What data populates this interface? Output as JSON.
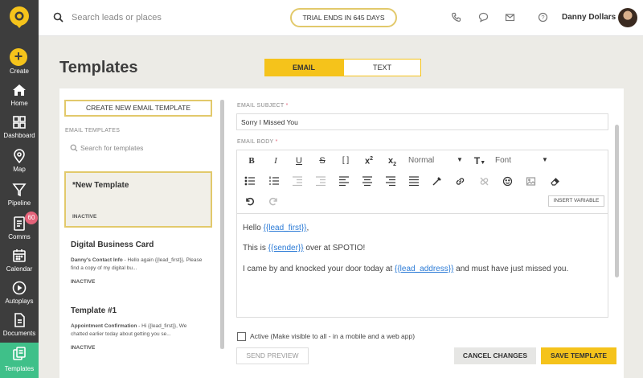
{
  "sidebar": {
    "items": [
      {
        "label": "Create",
        "icon": "plus-circle-icon"
      },
      {
        "label": "Home",
        "icon": "home-icon"
      },
      {
        "label": "Dashboard",
        "icon": "grid-icon"
      },
      {
        "label": "Map",
        "icon": "map-pin-icon"
      },
      {
        "label": "Pipeline",
        "icon": "funnel-icon"
      },
      {
        "label": "Comms",
        "icon": "document-icon",
        "badge": "60"
      },
      {
        "label": "Calendar",
        "icon": "calendar-icon"
      },
      {
        "label": "Autoplays",
        "icon": "play-circle-icon"
      },
      {
        "label": "Documents",
        "icon": "documents-icon"
      },
      {
        "label": "Templates",
        "icon": "templates-icon",
        "active": true
      }
    ]
  },
  "topbar": {
    "search_placeholder": "Search leads or places",
    "trial_text": "TRIAL ENDS IN 645 DAYS",
    "user_name": "Danny Dollars"
  },
  "page": {
    "title": "Templates",
    "tabs": [
      "EMAIL",
      "TEXT"
    ],
    "active_tab": "EMAIL"
  },
  "template_list": {
    "create_button": "CREATE NEW EMAIL TEMPLATE",
    "section_label": "EMAIL TEMPLATES",
    "search_placeholder": "Search for templates",
    "items": [
      {
        "title": "*New Template",
        "desc_bold": "",
        "desc": "",
        "status": "INACTIVE"
      },
      {
        "title": "Digital Business Card",
        "desc_bold": "Danny's Contact Info",
        "desc": " - Hello again {{lead_first}}, Please find a copy of my digital bu...",
        "status": "INACTIVE"
      },
      {
        "title": "Template #1",
        "desc_bold": "Appointment Confirmation",
        "desc": " - Hi {{lead_first}}, We chatted earlier today about getting you se...",
        "status": "INACTIVE"
      }
    ]
  },
  "editor": {
    "subject_label": "EMAIL SUBJECT",
    "required_mark": "*",
    "subject_value": "Sorry I Missed You",
    "body_label": "EMAIL BODY",
    "toolbar": {
      "paragraph_style": "Normal",
      "font": "Font",
      "insert_variable": "INSERT VARIABLE"
    },
    "body": {
      "line1_pre": "Hello ",
      "line1_token": "{{lead_first}}",
      "line1_post": ",",
      "line2_pre": "This is ",
      "line2_token": "{{sender}}",
      "line2_post": " over at SPOTIO!",
      "line3_pre": "I came by and knocked your door today at ",
      "line3_token": "{{lead_address}}",
      "line3_post": " and must have just missed you."
    },
    "active_label": "Active (Make visible to all - in a mobile and a web app)",
    "active_checked": false
  },
  "actions": {
    "send_preview": "SEND PREVIEW",
    "cancel": "CANCEL CHANGES",
    "save": "SAVE TEMPLATE"
  },
  "colors": {
    "brand_yellow": "#f5c31b",
    "sidebar_bg": "#3d3d3d",
    "active_green": "#3fc089",
    "badge_pink": "#e4637a",
    "link_blue": "#2a7ad6"
  }
}
